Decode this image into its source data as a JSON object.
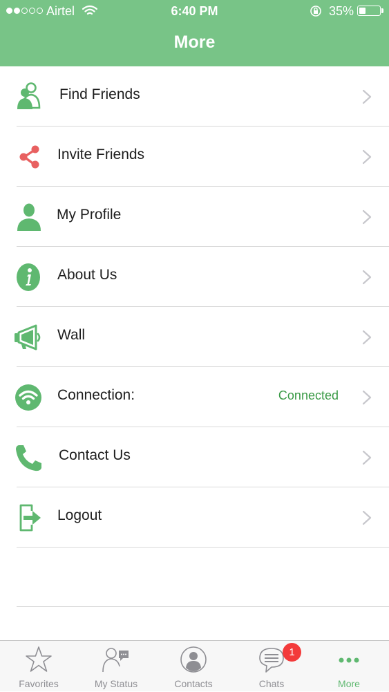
{
  "status_bar": {
    "carrier": "Airtel",
    "time": "6:40 PM",
    "battery_percent": "35%",
    "battery_level": 0.35,
    "signal_strength": 2,
    "signal_max": 5
  },
  "nav": {
    "title": "More"
  },
  "colors": {
    "header": "#78c487",
    "accent": "#5fb870",
    "share_icon": "#e86060",
    "connected_text": "#3a9a46",
    "badge": "#f33a3a"
  },
  "menu": {
    "items": [
      {
        "label": "Find Friends",
        "icon": "find-friends-icon"
      },
      {
        "label": "Invite Friends",
        "icon": "share-icon"
      },
      {
        "label": "My Profile",
        "icon": "profile-icon"
      },
      {
        "label": "About Us",
        "icon": "info-icon"
      },
      {
        "label": "Wall",
        "icon": "megaphone-icon"
      },
      {
        "label": "Connection:",
        "icon": "wifi-icon",
        "status": "Connected"
      },
      {
        "label": "Contact Us",
        "icon": "phone-icon"
      },
      {
        "label": "Logout",
        "icon": "logout-icon"
      }
    ]
  },
  "tabs": {
    "items": [
      {
        "label": "Favorites",
        "icon": "star-icon"
      },
      {
        "label": "My Status",
        "icon": "status-icon"
      },
      {
        "label": "Contacts",
        "icon": "contacts-icon"
      },
      {
        "label": "Chats",
        "icon": "chats-icon",
        "badge": "1"
      },
      {
        "label": "More",
        "icon": "more-icon",
        "active": true
      }
    ]
  }
}
